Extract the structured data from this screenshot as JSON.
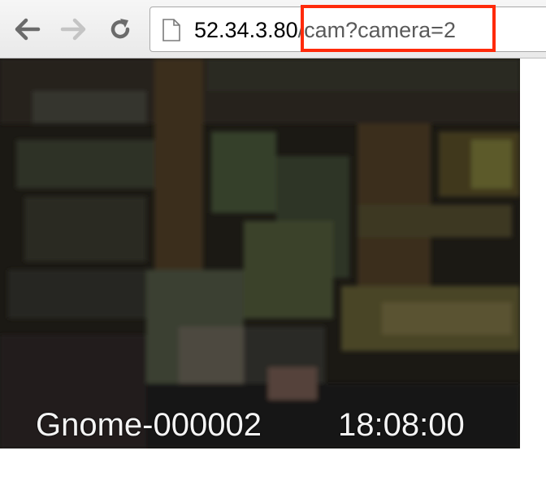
{
  "browser": {
    "url_host": "52.34.3.80",
    "url_path": "/cam?camera=2",
    "back_icon": "arrow-left-icon",
    "forward_icon": "arrow-right-icon",
    "reload_icon": "reload-icon",
    "page_icon": "document-icon",
    "highlight_color": "#ff2a0a"
  },
  "camera": {
    "camera_name": "Gnome-000002",
    "timestamp": "18:08:00"
  }
}
